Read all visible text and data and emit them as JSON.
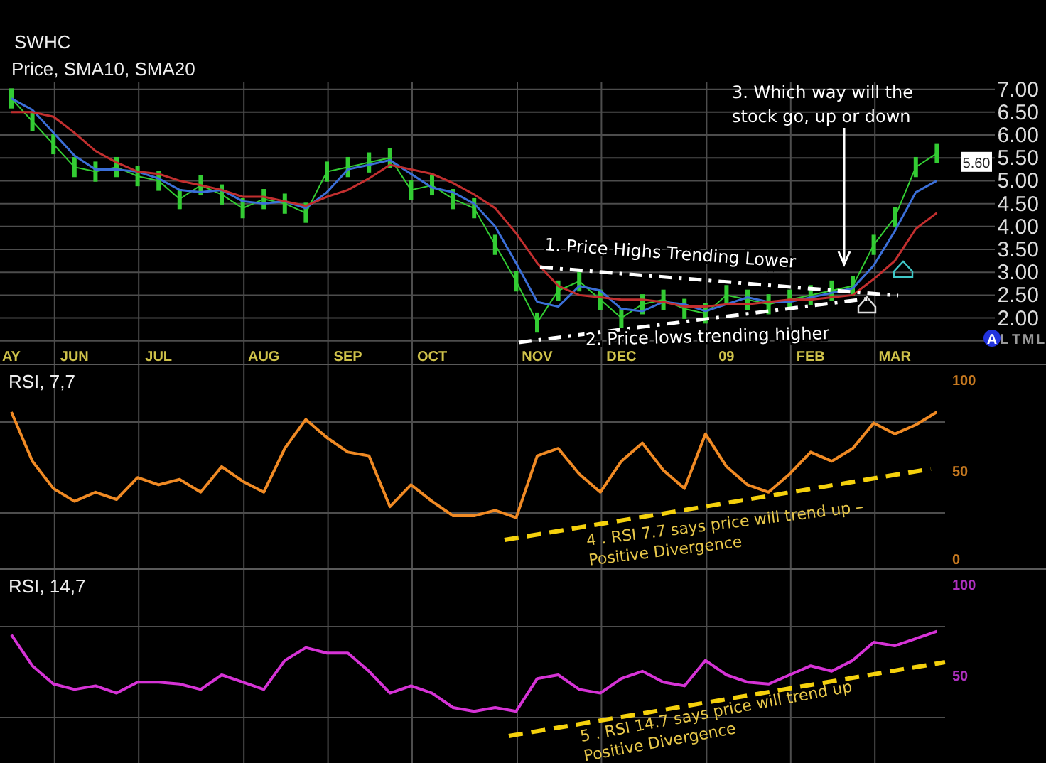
{
  "symbol": "SWHC",
  "price_chart": {
    "last_price": "5.60",
    "chart_data": {
      "type": "line",
      "title": "Price, SMA10, SMA20",
      "grid": true,
      "ylim": [
        1.0,
        7.15
      ],
      "categories": [
        "AY",
        null,
        null,
        "JUN",
        null,
        null,
        null,
        "JUL",
        null,
        null,
        null,
        null,
        "AUG",
        null,
        null,
        null,
        "SEP",
        null,
        null,
        null,
        "OCT",
        null,
        null,
        null,
        null,
        "NOV",
        null,
        null,
        null,
        "DEC",
        null,
        null,
        null,
        null,
        "09",
        null,
        null,
        null,
        "FEB",
        null,
        null,
        null,
        "MAR",
        null,
        null
      ],
      "yticks": [
        {
          "value": 7,
          "label": "7.00"
        },
        {
          "value": 6.5,
          "label": "6.50"
        },
        {
          "value": 6,
          "label": "6.00"
        },
        {
          "value": 5.5,
          "label": "5.50"
        },
        {
          "value": 5,
          "label": "5.00"
        },
        {
          "value": 4.5,
          "label": "4.50"
        },
        {
          "value": 4,
          "label": "4.00"
        },
        {
          "value": 3.5,
          "label": "3.50"
        },
        {
          "value": 3,
          "label": "3.00"
        },
        {
          "value": 2.5,
          "label": "2.50"
        },
        {
          "value": 2,
          "label": "2.00"
        }
      ],
      "series": [
        {
          "color": "#33cc33",
          "values": [
            6.8,
            6.3,
            5.8,
            5.3,
            5.2,
            5.3,
            5.1,
            5.0,
            4.6,
            4.9,
            4.7,
            4.4,
            4.6,
            4.5,
            4.3,
            5.2,
            5.3,
            5.4,
            5.5,
            4.8,
            4.9,
            4.6,
            4.4,
            3.6,
            2.8,
            1.9,
            2.6,
            2.8,
            2.4,
            2.0,
            2.3,
            2.4,
            2.2,
            2.1,
            2.5,
            2.4,
            2.3,
            2.4,
            2.5,
            2.6,
            2.7,
            3.6,
            4.2,
            5.3,
            5.6
          ]
        },
        {
          "color": "#3b6fd8",
          "values": [
            6.8,
            6.55,
            6.05,
            5.55,
            5.25,
            5.25,
            5.2,
            5.05,
            4.8,
            4.75,
            4.8,
            4.55,
            4.5,
            4.55,
            4.4,
            4.75,
            5.25,
            5.35,
            5.45,
            5.15,
            4.85,
            4.75,
            4.5,
            4.0,
            3.2,
            2.35,
            2.25,
            2.7,
            2.6,
            2.2,
            2.15,
            2.35,
            2.3,
            2.15,
            2.3,
            2.45,
            2.35,
            2.35,
            2.45,
            2.55,
            2.65,
            3.15,
            3.9,
            4.75,
            5.0
          ]
        },
        {
          "color": "#c22f2f",
          "values": [
            6.5,
            6.5,
            6.4,
            6.05,
            5.65,
            5.4,
            5.2,
            5.15,
            5.0,
            4.9,
            4.8,
            4.65,
            4.65,
            4.55,
            4.45,
            4.65,
            4.8,
            5.05,
            5.35,
            5.25,
            5.15,
            4.95,
            4.7,
            4.4,
            3.85,
            3.2,
            2.7,
            2.5,
            2.45,
            2.4,
            2.4,
            2.35,
            2.25,
            2.25,
            2.3,
            2.3,
            2.35,
            2.4,
            2.4,
            2.45,
            2.5,
            2.85,
            3.25,
            3.95,
            4.3
          ]
        }
      ]
    },
    "notes": [
      {
        "kind": "trend",
        "lines": [
          "1. Price Highs Trending Lower"
        ]
      },
      {
        "kind": "trend",
        "lines": [
          "2. Price lows trending higher"
        ]
      },
      {
        "kind": "arrow",
        "lines": [
          "3. Which way will the",
          "stock go, up or down"
        ]
      }
    ]
  },
  "legend_buttons": [
    {
      "label": "A",
      "selected": true
    },
    {
      "label": "L",
      "selected": false
    },
    {
      "label": "T",
      "selected": false
    },
    {
      "label": "M",
      "selected": false
    },
    {
      "label": "L",
      "selected": false
    }
  ],
  "rsi_charts": [
    {
      "chart_data": {
        "type": "line",
        "title": "RSI, 7,7",
        "grid": true,
        "ylim": [
          0,
          100
        ],
        "yticks": [
          100,
          50,
          0
        ],
        "series": [
          {
            "color": "#f08a24",
            "values": [
              82,
              55,
              40,
              33,
              38,
              34,
              46,
              42,
              45,
              38,
              52,
              44,
              38,
              62,
              78,
              68,
              60,
              58,
              30,
              42,
              33,
              25,
              25,
              28,
              24,
              58,
              62,
              48,
              38,
              55,
              65,
              50,
              40,
              70,
              52,
              42,
              38,
              48,
              60,
              55,
              62,
              76,
              70,
              75,
              82
            ]
          }
        ]
      },
      "notes": [
        {
          "kind": "trend",
          "lines": [
            "4 . RSI 7.7 says price will trend up –",
            "Positive Divergence"
          ]
        }
      ]
    },
    {
      "chart_data": {
        "type": "line",
        "title": "RSI, 14,7",
        "grid": true,
        "ylim": [
          0,
          100
        ],
        "yticks": [
          100,
          50
        ],
        "series": [
          {
            "color": "#d633d6",
            "values": [
              72,
              55,
              45,
              42,
              44,
              40,
              46,
              46,
              45,
              42,
              50,
              46,
              42,
              58,
              65,
              62,
              62,
              52,
              40,
              44,
              40,
              32,
              30,
              32,
              30,
              48,
              50,
              42,
              40,
              48,
              52,
              46,
              44,
              58,
              50,
              46,
              45,
              50,
              55,
              52,
              58,
              68,
              66,
              70,
              74
            ]
          }
        ]
      },
      "notes": [
        {
          "kind": "trend",
          "lines": [
            "5 . RSI 14.7 says price will trend up",
            "Positive Divergence"
          ]
        }
      ]
    }
  ]
}
